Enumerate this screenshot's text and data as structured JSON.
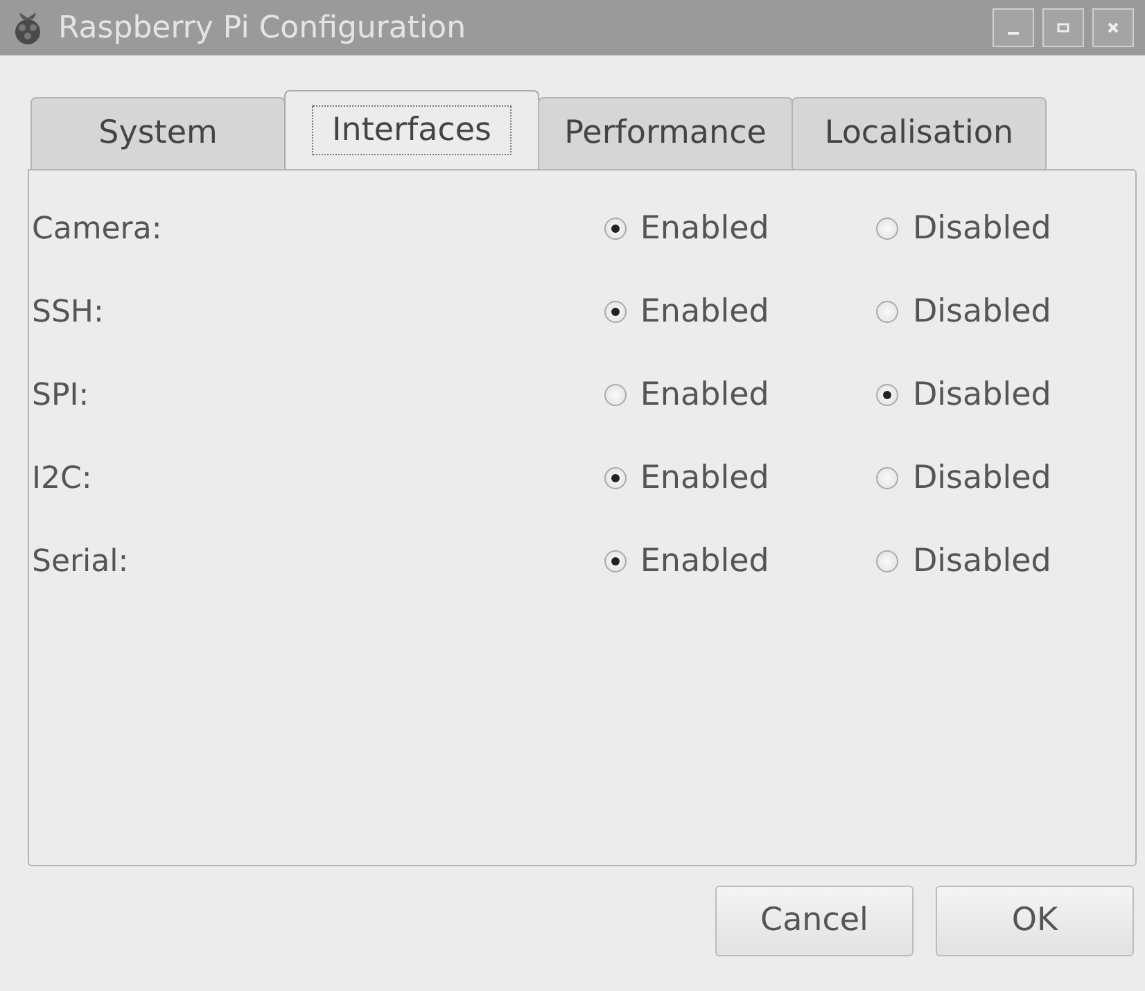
{
  "window": {
    "title": "Raspberry Pi Configuration"
  },
  "tabs": [
    {
      "label": "System",
      "selected": false
    },
    {
      "label": "Interfaces",
      "selected": true
    },
    {
      "label": "Performance",
      "selected": false
    },
    {
      "label": "Localisation",
      "selected": false
    }
  ],
  "settings": [
    {
      "label": "Camera:",
      "options": [
        {
          "label": "Enabled",
          "selected": true
        },
        {
          "label": "Disabled",
          "selected": false
        }
      ]
    },
    {
      "label": "SSH:",
      "options": [
        {
          "label": "Enabled",
          "selected": true
        },
        {
          "label": "Disabled",
          "selected": false
        }
      ]
    },
    {
      "label": "SPI:",
      "options": [
        {
          "label": "Enabled",
          "selected": false
        },
        {
          "label": "Disabled",
          "selected": true
        }
      ]
    },
    {
      "label": "I2C:",
      "options": [
        {
          "label": "Enabled",
          "selected": true
        },
        {
          "label": "Disabled",
          "selected": false
        }
      ]
    },
    {
      "label": "Serial:",
      "options": [
        {
          "label": "Enabled",
          "selected": true
        },
        {
          "label": "Disabled",
          "selected": false
        }
      ]
    }
  ],
  "buttons": [
    "Cancel",
    "OK"
  ]
}
